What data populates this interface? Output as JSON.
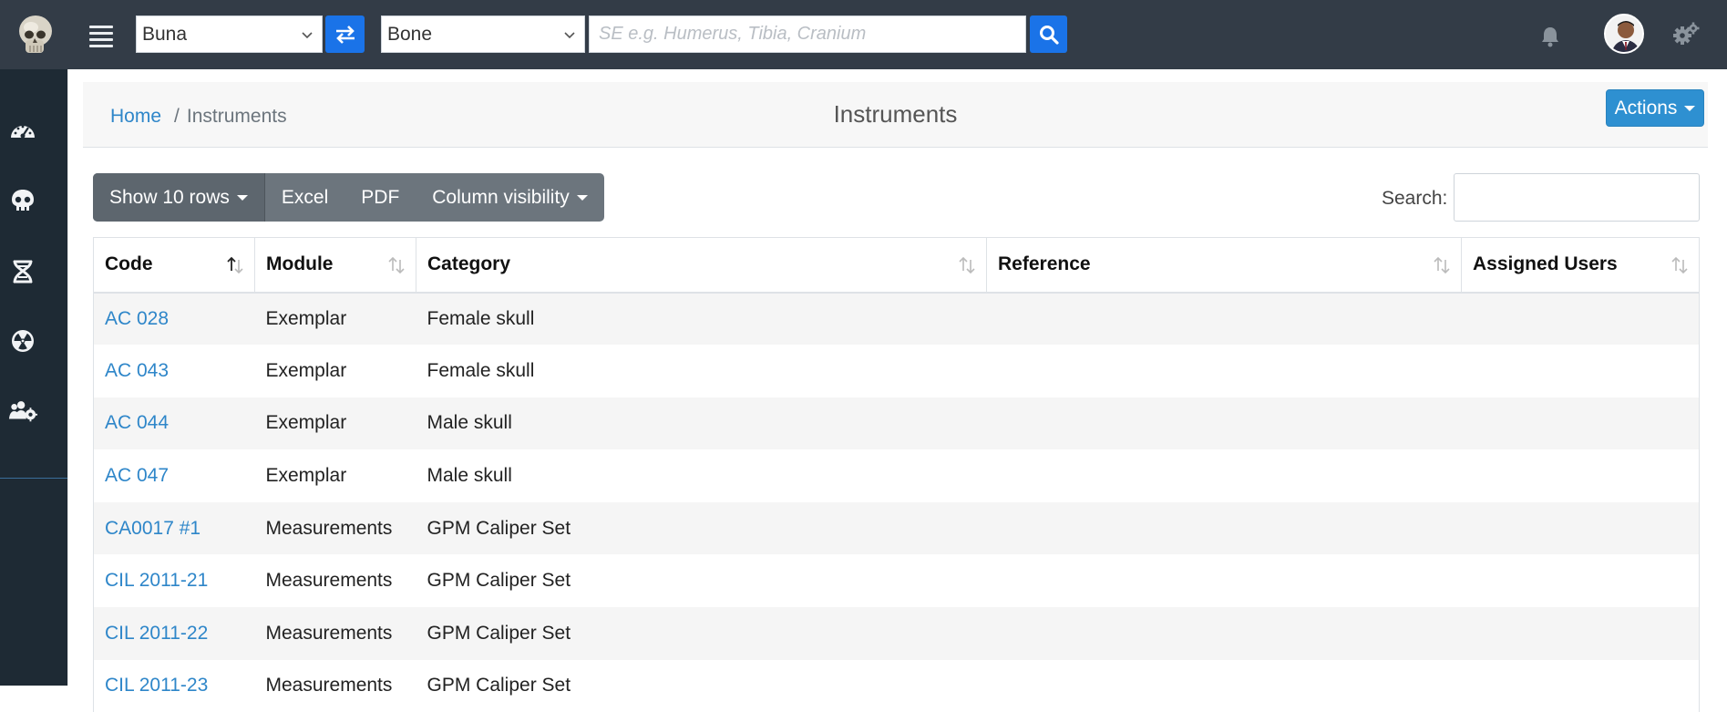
{
  "topbar": {
    "site_select": {
      "value": "Buna"
    },
    "element_select": {
      "value": "Bone"
    },
    "search": {
      "placeholder": "SE e.g. Humerus, Tibia, Cranium"
    }
  },
  "sidebar": {
    "items": [
      {
        "icon": "dashboard-icon"
      },
      {
        "icon": "skull-icon"
      },
      {
        "icon": "dna-icon"
      },
      {
        "icon": "radiation-icon"
      },
      {
        "icon": "users-gear-icon"
      }
    ]
  },
  "breadcrumb": {
    "home": "Home",
    "current": "Instruments"
  },
  "page": {
    "title": "Instruments",
    "actions_label": "Actions"
  },
  "toolbar": {
    "show_rows": "Show 10 rows",
    "excel": "Excel",
    "pdf": "PDF",
    "column_visibility": "Column visibility",
    "search_label": "Search:"
  },
  "table": {
    "columns": [
      "Code",
      "Module",
      "Category",
      "Reference",
      "Assigned Users"
    ],
    "rows": [
      {
        "code": "AC 028",
        "module": "Exemplar",
        "category": "Female skull",
        "reference": "",
        "users": ""
      },
      {
        "code": "AC 043",
        "module": "Exemplar",
        "category": "Female skull",
        "reference": "",
        "users": ""
      },
      {
        "code": "AC 044",
        "module": "Exemplar",
        "category": "Male skull",
        "reference": "",
        "users": ""
      },
      {
        "code": "AC 047",
        "module": "Exemplar",
        "category": "Male skull",
        "reference": "",
        "users": ""
      },
      {
        "code": "CA0017 #1",
        "module": "Measurements",
        "category": "GPM Caliper Set",
        "reference": "",
        "users": ""
      },
      {
        "code": "CIL 2011-21",
        "module": "Measurements",
        "category": "GPM Caliper Set",
        "reference": "",
        "users": ""
      },
      {
        "code": "CIL 2011-22",
        "module": "Measurements",
        "category": "GPM Caliper Set",
        "reference": "",
        "users": ""
      },
      {
        "code": "CIL 2011-23",
        "module": "Measurements",
        "category": "GPM Caliper Set",
        "reference": "",
        "users": ""
      }
    ]
  },
  "colors": {
    "topbar": "#333c47",
    "sidebar": "#1e2a34",
    "accent": "#1a73e8",
    "link": "#2e86c9"
  }
}
